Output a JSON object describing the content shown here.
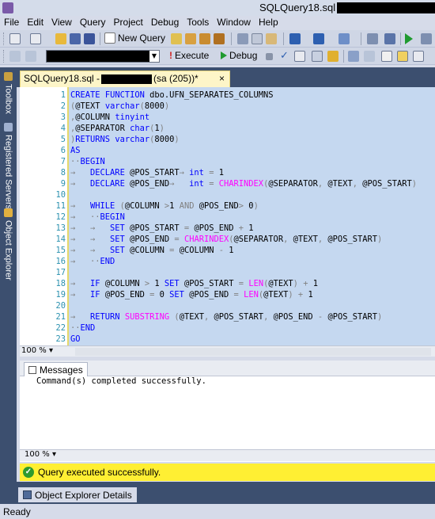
{
  "window": {
    "title": "SQLQuery18.sql -"
  },
  "menu": [
    "File",
    "Edit",
    "View",
    "Query",
    "Project",
    "Debug",
    "Tools",
    "Window",
    "Help"
  ],
  "toolbar1": {
    "new_query_label": "New Query"
  },
  "toolbar2": {
    "execute_label": "Execute",
    "debug_label": "Debug"
  },
  "side_tabs": [
    "Toolbox",
    "Registered Servers",
    "Object Explorer"
  ],
  "doc_tab": {
    "prefix": "SQLQuery18.sql -",
    "suffix": "(sa (205))*",
    "close": "×"
  },
  "editor": {
    "lines": [
      {
        "n": "1",
        "html": "<span class='kw'>CREATE</span> <span class='kw'>FUNCTION</span> <span class='tx'>dbo.UFN_SEPARATES_COLUMNS</span>"
      },
      {
        "n": "2",
        "html": "<span class='gr'>(</span><span class='tx'>@TEXT</span> <span class='ty'>varchar</span><span class='gr'>(</span>8000<span class='gr'>)</span>"
      },
      {
        "n": "3",
        "html": "<span class='gr'>,</span><span class='tx'>@COLUMN</span> <span class='ty'>tinyint</span>"
      },
      {
        "n": "4",
        "html": "<span class='gr'>,</span><span class='tx'>@SEPARATOR</span> <span class='ty'>char</span><span class='gr'>(</span>1<span class='gr'>)</span>"
      },
      {
        "n": "5",
        "html": "<span class='gr'>)</span><span class='kw'>RETURNS</span> <span class='ty'>varchar</span><span class='gr'>(</span>8000<span class='gr'>)</span>"
      },
      {
        "n": "6",
        "html": "<span class='kw'>AS</span>"
      },
      {
        "n": "7",
        "html": "<span class='gr'>··</span><span class='kw'>BEGIN</span>"
      },
      {
        "n": "8",
        "html": "<span class='gr'>→   </span><span class='kw'>DECLARE</span> <span class='tx'>@POS_START</span><span class='gr'>→ </span><span class='ty'>int</span> <span class='gr'>=</span> 1"
      },
      {
        "n": "9",
        "html": "<span class='gr'>→   </span><span class='kw'>DECLARE</span> <span class='tx'>@POS_END</span><span class='gr'>→   </span><span class='ty'>int</span> <span class='gr'>=</span> <span class='fn'>CHARINDEX</span><span class='gr'>(</span><span class='tx'>@SEPARATOR</span><span class='gr'>,</span> <span class='tx'>@TEXT</span><span class='gr'>,</span> <span class='tx'>@POS_START</span><span class='gr'>)</span>"
      },
      {
        "n": "10",
        "html": ""
      },
      {
        "n": "11",
        "html": "<span class='gr'>→   </span><span class='kw'>WHILE</span> <span class='gr'>(</span><span class='tx'>@COLUMN</span> <span class='gr'>&gt;</span>1 <span class='gr'>AND</span> <span class='tx'>@POS_END</span><span class='gr'>&gt;</span> 0<span class='gr'>)</span>"
      },
      {
        "n": "12",
        "html": "<span class='gr'>→   ··</span><span class='kw'>BEGIN</span>"
      },
      {
        "n": "13",
        "html": "<span class='gr'>→   →   </span><span class='kw'>SET</span> <span class='tx'>@POS_START</span> <span class='gr'>=</span> <span class='tx'>@POS_END</span> <span class='gr'>+</span> 1"
      },
      {
        "n": "14",
        "html": "<span class='gr'>→   →   </span><span class='kw'>SET</span> <span class='tx'>@POS_END</span> <span class='gr'>=</span> <span class='fn'>CHARINDEX</span><span class='gr'>(</span><span class='tx'>@SEPARATOR</span><span class='gr'>,</span> <span class='tx'>@TEXT</span><span class='gr'>,</span> <span class='tx'>@POS_START</span><span class='gr'>)</span>"
      },
      {
        "n": "15",
        "html": "<span class='gr'>→   →   </span><span class='kw'>SET</span> <span class='tx'>@COLUMN</span> <span class='gr'>=</span> <span class='tx'>@COLUMN</span> <span class='gr'>-</span> 1"
      },
      {
        "n": "16",
        "html": "<span class='gr'>→   ··</span><span class='kw'>END</span>"
      },
      {
        "n": "17",
        "html": ""
      },
      {
        "n": "18",
        "html": "<span class='gr'>→   </span><span class='kw'>IF</span> <span class='tx'>@COLUMN</span> <span class='gr'>&gt;</span> 1 <span class='kw'>SET</span> <span class='tx'>@POS_START</span> <span class='gr'>=</span> <span class='fn'>LEN</span><span class='gr'>(</span><span class='tx'>@TEXT</span><span class='gr'>)</span> <span class='gr'>+</span> 1"
      },
      {
        "n": "19",
        "html": "<span class='gr'>→   </span><span class='kw'>IF</span> <span class='tx'>@POS_END</span> <span class='gr'>=</span> 0 <span class='kw'>SET</span> <span class='tx'>@POS_END</span> <span class='gr'>=</span> <span class='fn'>LEN</span><span class='gr'>(</span><span class='tx'>@TEXT</span><span class='gr'>)</span> <span class='gr'>+</span> 1"
      },
      {
        "n": "20",
        "html": ""
      },
      {
        "n": "21",
        "html": "<span class='gr'>→   </span><span class='kw'>RETURN</span> <span class='fn'>SUBSTRING</span> <span class='gr'>(</span><span class='tx'>@TEXT</span><span class='gr'>,</span> <span class='tx'>@POS_START</span><span class='gr'>,</span> <span class='tx'>@POS_END</span> <span class='gr'>-</span> <span class='tx'>@POS_START</span><span class='gr'>)</span>"
      },
      {
        "n": "22",
        "html": "<span class='gr'>··</span><span class='kw'>END</span>"
      },
      {
        "n": "23",
        "html": "<span class='kw'>GO</span>"
      }
    ]
  },
  "editor_zoom": "100 %",
  "results": {
    "tab_label": "Messages",
    "message": "Command(s) completed successfully.",
    "zoom": "100 %"
  },
  "status_strip": {
    "text": "Query executed successfully.",
    "color": "#ffef33"
  },
  "bottom_tab": {
    "label": "Object Explorer Details"
  },
  "statusbar": {
    "text": "Ready"
  }
}
